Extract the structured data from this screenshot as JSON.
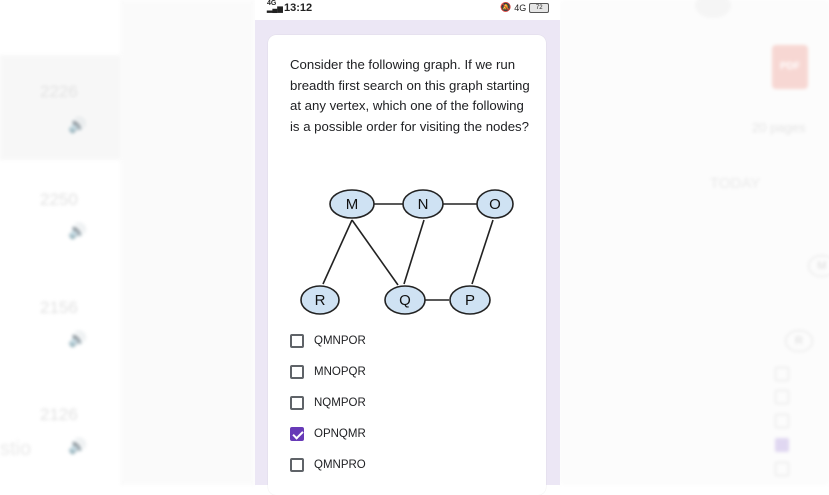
{
  "status_bar": {
    "signal": "4G",
    "time": "13:12",
    "network": "4G",
    "battery": "72"
  },
  "question": {
    "text": "Consider the following graph. If we run breadth first search on this graph starting at any vertex, which one of the following is a possible order for visiting the nodes?"
  },
  "graph": {
    "nodes": [
      "M",
      "N",
      "O",
      "R",
      "Q",
      "P"
    ],
    "edges": [
      [
        "M",
        "N"
      ],
      [
        "N",
        "O"
      ],
      [
        "M",
        "R"
      ],
      [
        "M",
        "Q"
      ],
      [
        "N",
        "Q"
      ],
      [
        "Q",
        "P"
      ],
      [
        "O",
        "P"
      ]
    ]
  },
  "options": [
    {
      "label": "QMNPOR",
      "checked": false
    },
    {
      "label": "MNOPQR",
      "checked": false
    },
    {
      "label": "NQMPOR",
      "checked": false
    },
    {
      "label": "OPNQMR",
      "checked": true
    },
    {
      "label": "QMNPRO",
      "checked": false
    }
  ],
  "colors": {
    "accent": "#673ab7",
    "form_bg": "#ece7f5",
    "node_fill": "#cfe2f3"
  },
  "background": {
    "times": [
      "2226",
      "2250",
      "2156",
      "2126"
    ],
    "pdf_badge": "PDF",
    "pages_text": "20 pages",
    "today_label": "TODAY",
    "studio_text": "stio"
  }
}
